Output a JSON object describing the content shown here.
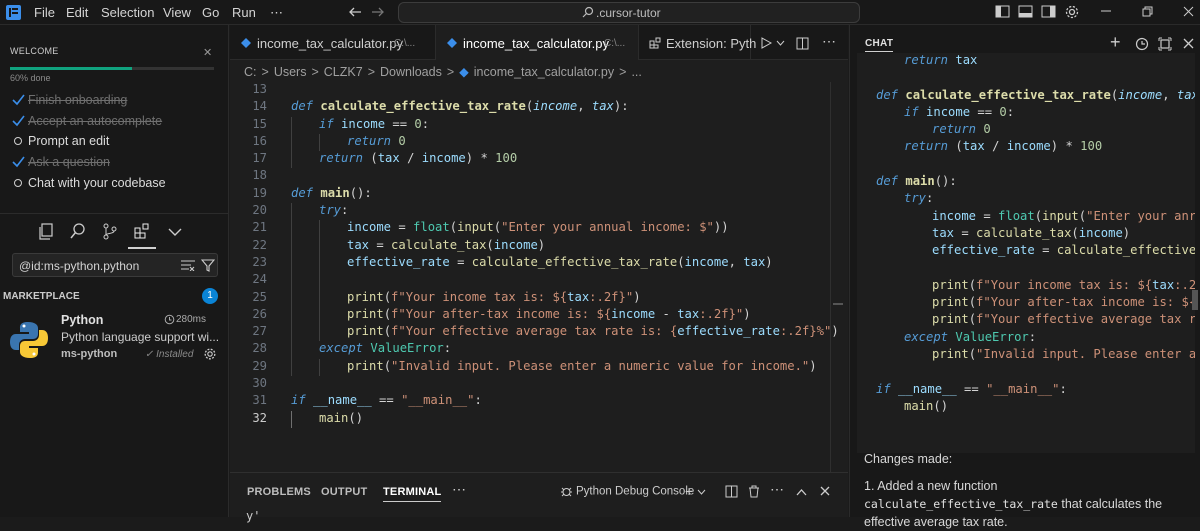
{
  "titlebar": {
    "menus": [
      "File",
      "Edit",
      "Selection",
      "View",
      "Go",
      "Run",
      "⋯"
    ],
    "command_center": ".cursor-tutor"
  },
  "welcome": {
    "title": "WELCOME",
    "progress_text": "60% done",
    "progress_percent": 60,
    "steps": [
      {
        "label": "Finish onboarding",
        "done": true
      },
      {
        "label": "Accept an autocomplete",
        "done": true
      },
      {
        "label": "Prompt an edit",
        "done": false
      },
      {
        "label": "Ask a question",
        "done": true
      },
      {
        "label": "Chat with your codebase",
        "done": false
      }
    ]
  },
  "extensions": {
    "search_value": "@id:ms-python.python",
    "marketplace_title": "MARKETPLACE",
    "badge": "1",
    "item": {
      "name": "Python",
      "time": "280ms",
      "description": "Python language support wi...",
      "publisher": "ms-python",
      "installed": "✓ Installed"
    }
  },
  "editor": {
    "tabs": [
      {
        "name": "income_tax_calculator.py",
        "dir": "C:\\..."
      },
      {
        "name": "income_tax_calculator.py",
        "dir": "C:\\..."
      },
      {
        "name": "Extension: Pyth",
        "dir": ""
      }
    ],
    "breadcrumb": [
      "C:",
      ">",
      "Users",
      ">",
      "CLZK7",
      ">",
      "Downloads",
      ">",
      "income_tax_calculator.py",
      ">",
      "..."
    ],
    "line_numbers": [
      "13",
      "14",
      "15",
      "16",
      "17",
      "18",
      "19",
      "20",
      "21",
      "22",
      "23",
      "24",
      "25",
      "26",
      "27",
      "28",
      "29",
      "30",
      "31",
      "32"
    ],
    "current_line": "32"
  },
  "code": {
    "l14": [
      "def ",
      "calculate_effective_tax_rate",
      "(",
      "income",
      ", ",
      "tax",
      "):"
    ],
    "l15": [
      "if ",
      "income",
      " == ",
      "0",
      ":"
    ],
    "l16": [
      "return ",
      "0"
    ],
    "l17": [
      "return ",
      "(",
      "tax",
      " / ",
      "income",
      ") * ",
      "100"
    ],
    "l19": [
      "def ",
      "main",
      "():"
    ],
    "l20": [
      "try",
      ":"
    ],
    "l21": [
      "income",
      " = ",
      "float",
      "(",
      "input",
      "(",
      "\"Enter your annual income: $\"",
      "))"
    ],
    "l22": [
      "tax",
      " = ",
      "calculate_tax",
      "(",
      "income",
      ")"
    ],
    "l23": [
      "effective_rate",
      " = ",
      "calculate_effective_tax_rate",
      "(",
      "income",
      ", ",
      "tax",
      ")"
    ],
    "l25": [
      "print",
      "(",
      "f\"Your income tax is: ${",
      "tax",
      ":.2f}\"",
      ")"
    ],
    "l26": [
      "print",
      "(",
      "f\"Your after-tax income is: ${",
      "income",
      " - ",
      "tax",
      ":.2f}\"",
      ")"
    ],
    "l27": [
      "print",
      "(",
      "f\"Your effective average tax rate is: {",
      "effective_rate",
      ":.2f}%\"",
      ")"
    ],
    "l28": [
      "except ",
      "ValueError",
      ":"
    ],
    "l29": [
      "print",
      "(",
      "\"Invalid input. Please enter a numeric value for income.\"",
      ")"
    ],
    "l31": [
      "if ",
      "__name__",
      " == ",
      "\"__main__\"",
      ":"
    ],
    "l32": [
      "main",
      "()"
    ]
  },
  "panel": {
    "tabs": [
      "PROBLEMS",
      "OUTPUT",
      "TERMINAL"
    ],
    "active": "TERMINAL",
    "debug_console": "Python Debug Console",
    "terminal_line": "y'"
  },
  "chat": {
    "title": "CHAT",
    "code": {
      "c0": [
        "return ",
        "tax"
      ],
      "c2": [
        "def ",
        "calculate_effective_tax_rate",
        "(",
        "income",
        ", ",
        "tax"
      ],
      "c3": [
        "if ",
        "income",
        " == ",
        "0",
        ":"
      ],
      "c4": [
        "return ",
        "0"
      ],
      "c5": [
        "return ",
        "(",
        "tax",
        " / ",
        "income",
        ") * ",
        "100"
      ],
      "c7": [
        "def ",
        "main",
        "():"
      ],
      "c8": [
        "try",
        ":"
      ],
      "c9": [
        "income",
        " = ",
        "float",
        "(",
        "input",
        "(",
        "\"Enter your anr"
      ],
      "c10": [
        "tax",
        " = ",
        "calculate_tax",
        "(",
        "income",
        ")"
      ],
      "c11": [
        "effective_rate",
        " = ",
        "calculate_effective"
      ],
      "c13": [
        "print",
        "(",
        "f\"Your income tax is: ${",
        "tax",
        ":.2"
      ],
      "c14": [
        "print",
        "(",
        "f\"Your after-tax income is: ${"
      ],
      "c15": [
        "print",
        "(",
        "f\"Your effective average tax r"
      ],
      "c16": [
        "except ",
        "ValueError",
        ":"
      ],
      "c17": [
        "print",
        "(",
        "\"Invalid input. Please enter a"
      ],
      "c19": [
        "if ",
        "__name__",
        " == ",
        "\"__main__\"",
        ":"
      ],
      "c20": [
        "main",
        "()"
      ]
    },
    "changes_heading": "Changes made:",
    "change_1_prefix": "1. Added a new function ",
    "change_1_code": "calculate_effective_tax_rate",
    "change_1_suffix": " that calculates the effective average tax rate."
  }
}
